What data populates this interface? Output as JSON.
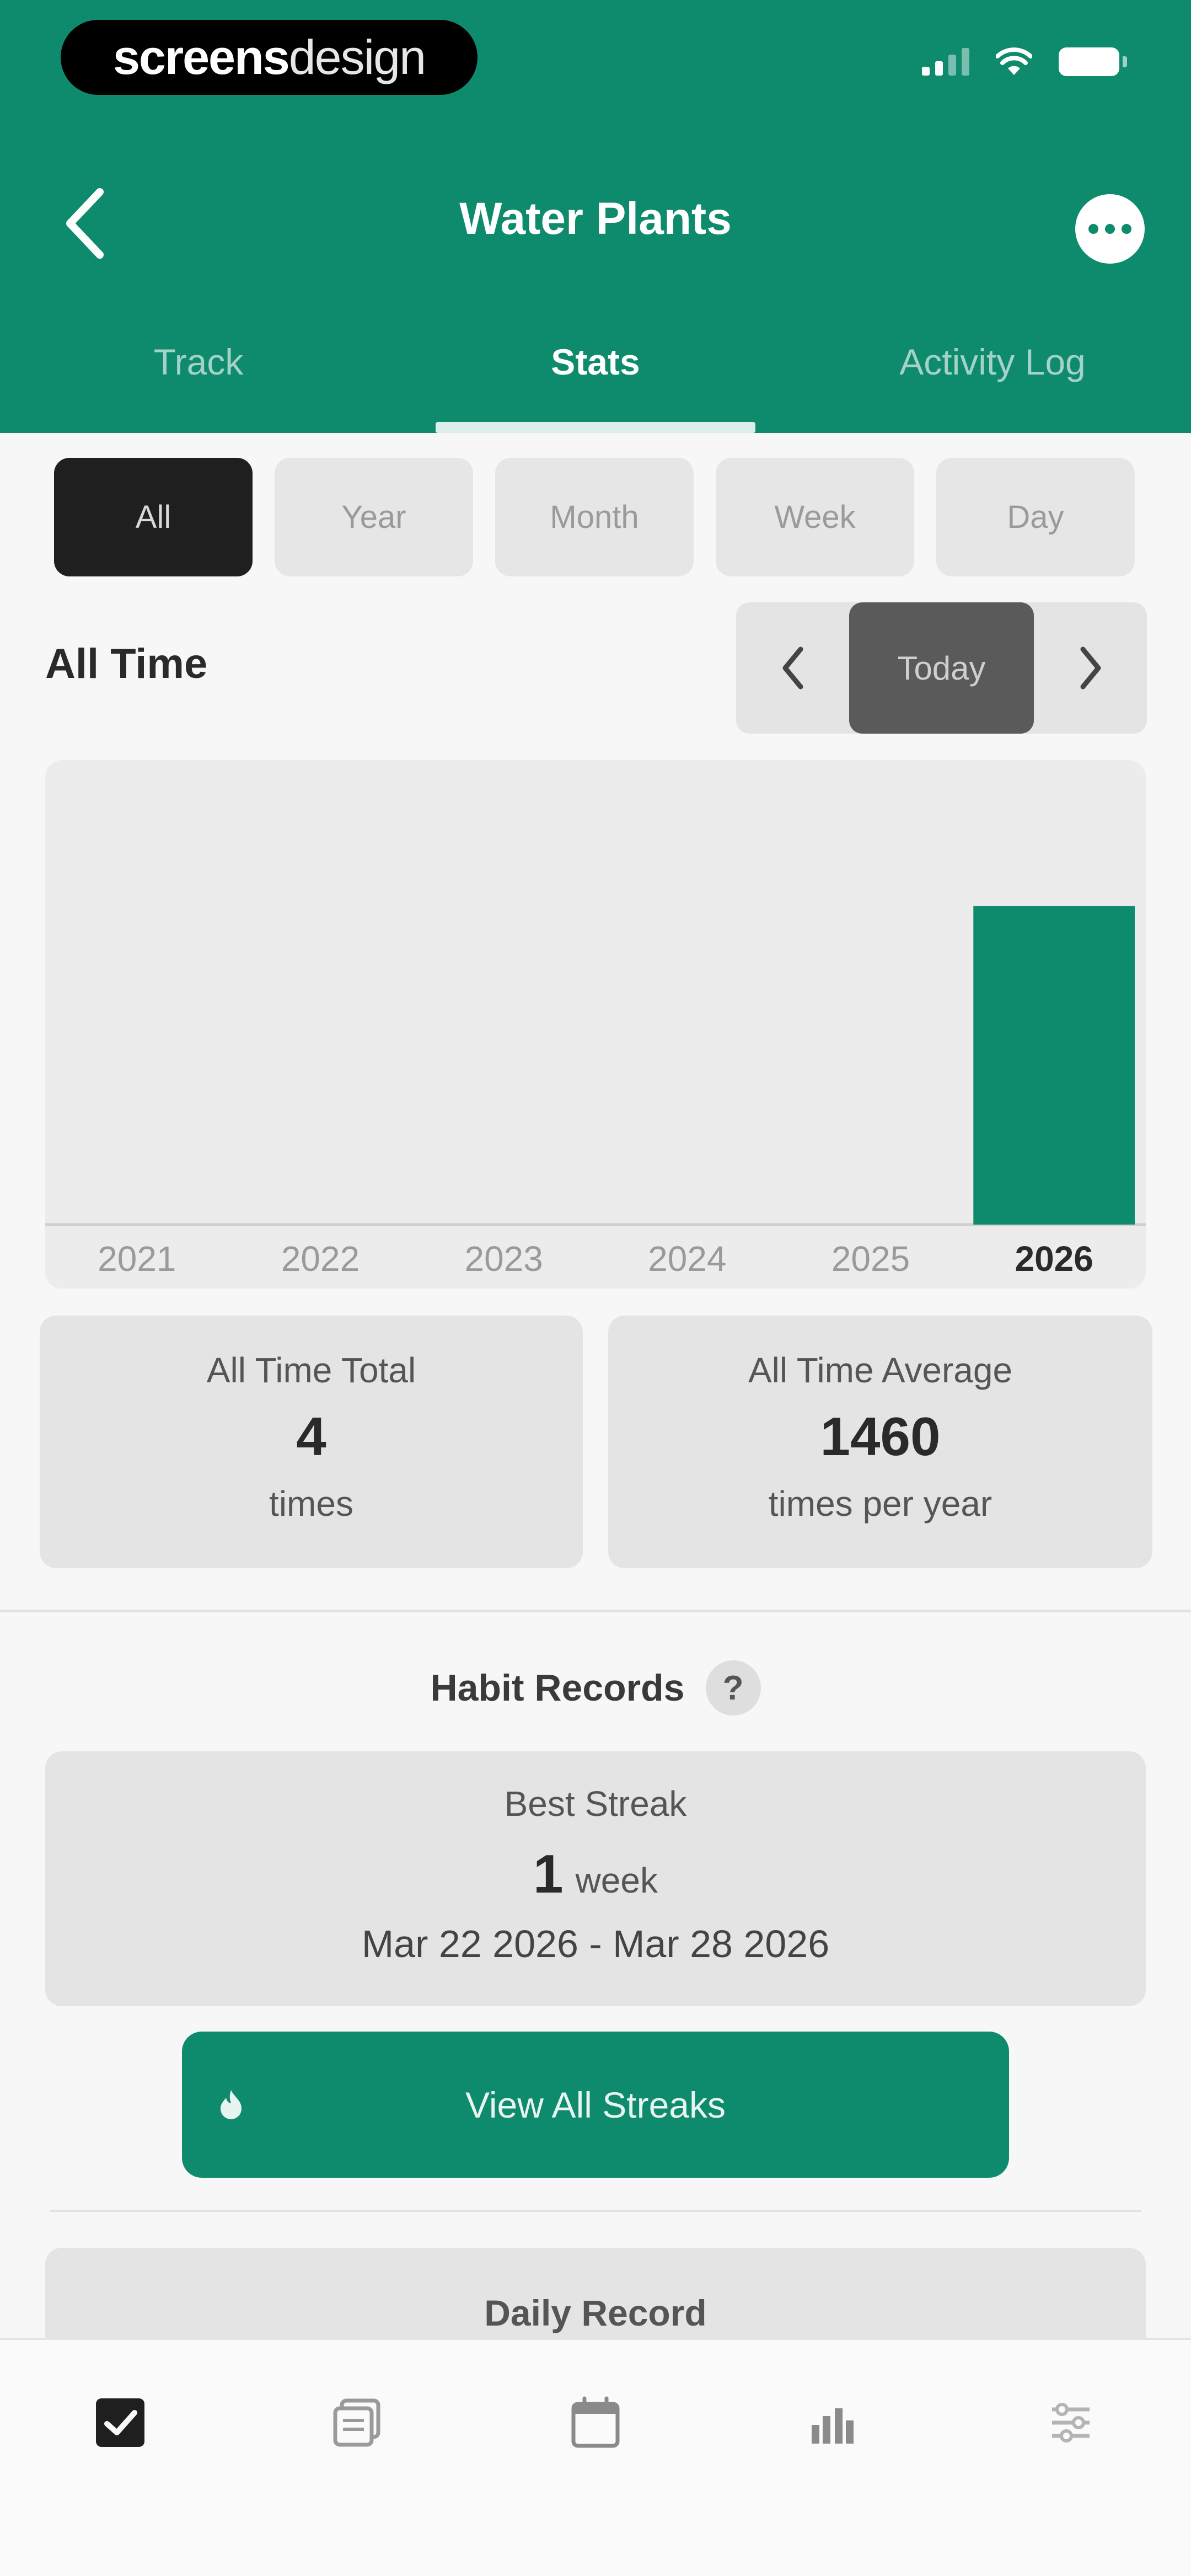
{
  "status_bar": {
    "brand_part1": "screens",
    "brand_part2": "design"
  },
  "header": {
    "title": "Water Plants"
  },
  "tabs": [
    {
      "label": "Track",
      "active": false
    },
    {
      "label": "Stats",
      "active": true
    },
    {
      "label": "Activity Log",
      "active": false
    }
  ],
  "range_selector": [
    {
      "label": "All",
      "active": true
    },
    {
      "label": "Year",
      "active": false
    },
    {
      "label": "Month",
      "active": false
    },
    {
      "label": "Week",
      "active": false
    },
    {
      "label": "Day",
      "active": false
    }
  ],
  "period": {
    "title": "All Time",
    "today_label": "Today"
  },
  "chart_data": {
    "type": "bar",
    "categories": [
      "2021",
      "2022",
      "2023",
      "2024",
      "2025",
      "2026"
    ],
    "values": [
      0,
      0,
      0,
      0,
      0,
      4
    ],
    "highlight_category": "2026",
    "ylim": [
      0,
      5
    ],
    "grid": false,
    "bar_color": "#0e8a6c"
  },
  "stats": {
    "total": {
      "label": "All Time Total",
      "value": "4",
      "unit": "times"
    },
    "average": {
      "label": "All Time Average",
      "value": "1460",
      "unit": "times per year"
    }
  },
  "records": {
    "title": "Habit Records",
    "help_glyph": "?",
    "best_streak": {
      "label": "Best Streak",
      "value": "1",
      "unit": "week",
      "range": "Mar 22 2026 - Mar 28 2026"
    },
    "view_all_label": "View All Streaks",
    "daily_record_label": "Daily Record"
  },
  "bottom_nav": [
    {
      "icon": "checkbox-icon",
      "active": true
    },
    {
      "icon": "journal-icon",
      "active": false
    },
    {
      "icon": "calendar-icon",
      "active": false
    },
    {
      "icon": "stats-icon",
      "active": false
    },
    {
      "icon": "settings-icon",
      "active": false
    }
  ],
  "colors": {
    "accent": "#0e8a6c",
    "background": "#f7f7f7",
    "card": "#e4e4e4"
  }
}
